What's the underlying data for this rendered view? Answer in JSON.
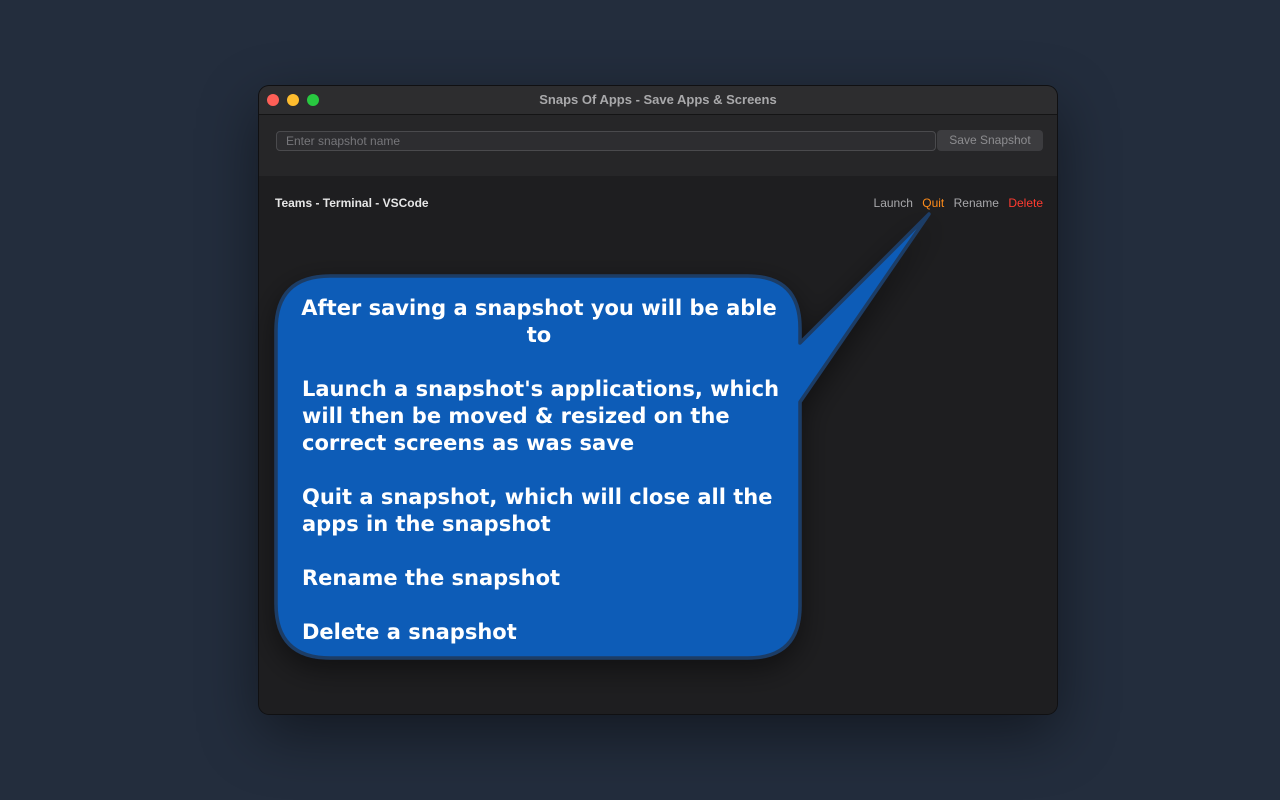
{
  "window": {
    "title": "Snaps Of Apps - Save Apps & Screens"
  },
  "toolbar": {
    "snapshot_name_placeholder": "Enter snapshot name",
    "snapshot_name_value": "",
    "save_label": "Save Snapshot"
  },
  "snapshots": [
    {
      "name": "Teams - Terminal - VSCode",
      "actions": {
        "launch": "Launch",
        "quit": "Quit",
        "rename": "Rename",
        "delete": "Delete"
      }
    }
  ],
  "callout": {
    "heading": "After saving a snapshot you will be able to",
    "items": [
      "Launch a snapshot's applications, which will then be moved & resized on the correct screens as was save",
      "Quit a snapshot, which will close all the apps in the snapshot",
      "Rename the snapshot",
      "Delete a snapshot"
    ]
  },
  "colors": {
    "background": "#232d3d",
    "callout_fill": "#0b5cb7",
    "callout_border": "#1f3c66",
    "quit_accent": "#ff8c1a",
    "delete_accent": "#ff3b30",
    "traffic_close": "#fe5f57",
    "traffic_minimize": "#febc2e",
    "traffic_maximize": "#28c840"
  }
}
